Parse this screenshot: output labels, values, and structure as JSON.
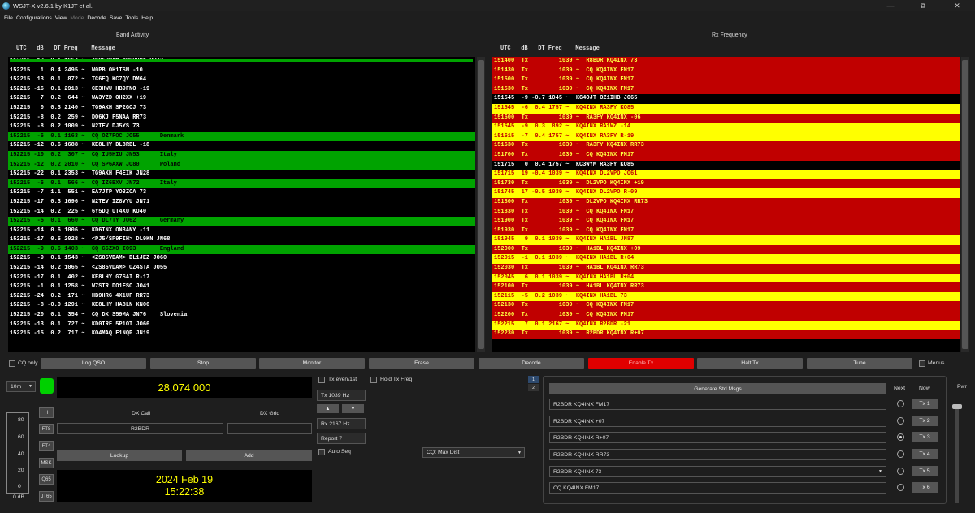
{
  "window": {
    "title": "WSJT-X   v2.6.1   by K1JT et al.",
    "min": "—",
    "max": "⧉",
    "close": "✕"
  },
  "menu": [
    "File",
    "Configurations",
    "View",
    "Mode",
    "Decode",
    "Save",
    "Tools",
    "Help"
  ],
  "band_activity": {
    "title": "Band Activity",
    "header": "UTC   dB   DT Freq    Message",
    "rows": [
      {
        "t": "152215 -13  0.1 1654 ~  ZS85VDAM <DH0VB> RR73",
        "s": "b"
      },
      {
        "t": "152215   1  0.4 2495 ~  W0PB OH1TSM -10",
        "s": "b"
      },
      {
        "t": "152215  13  0.1  872 ~  TC6EQ KC7QY DM64",
        "s": "b"
      },
      {
        "t": "152215 -16  0.1 2913 ~  CE3HWU HB9FNO -19",
        "s": "b"
      },
      {
        "t": "152215   7  0.2  644 ~  WA3YZD OH2XX +19",
        "s": "b"
      },
      {
        "t": "152215   0  0.3 2140 ~  TG9AKH SP2GCJ 73",
        "s": "b"
      },
      {
        "t": "152215  -8  0.2  259 ~  DO6KJ F5NAA RR73",
        "s": "b"
      },
      {
        "t": "152215  -8  0.2 1009 ~  N2TEV DJ5YS 73",
        "s": "b"
      },
      {
        "t": "152215  -6  0.1 1163 ~  CQ OZ7FOC JO55      Denmark",
        "s": "g"
      },
      {
        "t": "152215 -12  0.6 1688 ~  KE8LHY DL8RBL -18",
        "s": "b"
      },
      {
        "t": "152215 -10  0.2  307 ~  CQ IU5HIU JN53      Italy",
        "s": "g"
      },
      {
        "t": "152215 -12  0.2 2010 ~  CQ SP6AXW JO80      Poland",
        "s": "g"
      },
      {
        "t": "152215 -22  0.1 2353 ~  TG9AKH F4EIK JN28",
        "s": "b"
      },
      {
        "t": "152215  -6  0.1  566 ~  CQ IZ6BXV JN72      Italy",
        "s": "g"
      },
      {
        "t": "152215  -7  1.1  551 ~  EA7JTP YO3ZCA 73",
        "s": "b"
      },
      {
        "t": "152215 -17  0.3 1696 ~  N2TEV IZ8VYU JN71",
        "s": "b"
      },
      {
        "t": "152215 -14  0.2  225 ~  6Y5DQ UT4XU KO40",
        "s": "b"
      },
      {
        "t": "152215  -5  0.1  660 ~  CQ DL7TY JO62       Germany",
        "s": "g"
      },
      {
        "t": "152215 -14  0.6 1006 ~  KD6INX ON3ANY -11",
        "s": "b"
      },
      {
        "t": "152215 -17  0.5 2028 ~  <PJ5/SP9FIH> DL9KN JN68",
        "s": "b"
      },
      {
        "t": "152215  -9  0.6 1403 ~  CQ G6ZXO IO93       England",
        "s": "g"
      },
      {
        "t": "152215  -9  0.1 1543 ~  <ZS85VDAM> DL1JEZ JO60",
        "s": "b"
      },
      {
        "t": "152215 -14  0.2 1065 ~  <ZS85VDAM> OZ4STA JO55",
        "s": "b"
      },
      {
        "t": "152215 -17  0.1  402 ~  KE8LHY G7SAI R-17",
        "s": "b"
      },
      {
        "t": "152215  -1  0.1 1258 ~  W7STR DO1FSC JO41",
        "s": "b"
      },
      {
        "t": "152215 -24  0.2  171 ~  HB9HRG 4X1UF RR73",
        "s": "b"
      },
      {
        "t": "152215  -8 -0.0 1291 ~  KE8LHY HA8LN KN06",
        "s": "b"
      },
      {
        "t": "152215 -20  0.1  354 ~  CQ DX S59MA JN76    Slovenia",
        "s": "cq"
      },
      {
        "t": "152215 -13  0.1  727 ~  KD0IRF 5P1OT JO66",
        "s": "b"
      },
      {
        "t": "152215 -15  0.2  717 ~  KO4MAQ F1NQP JN19",
        "s": "b"
      }
    ]
  },
  "rx_frequency": {
    "title": "Rx Frequency",
    "header": "UTC   dB   DT Freq    Message",
    "rows": [
      {
        "t": "151400  Tx         1039 ~  R8BDR KQ4INX 73",
        "s": "r"
      },
      {
        "t": "151430  Tx         1039 ~  CQ KQ4INX FM17",
        "s": "r"
      },
      {
        "t": "151500  Tx         1039 ~  CQ KQ4INX FM17",
        "s": "r"
      },
      {
        "t": "151530  Tx         1039 ~  CQ KQ4INX FM17",
        "s": "r"
      },
      {
        "t": "151545  -9 -0.7 1045 ~  KG4OJT OZ1IHB JO65",
        "s": "b"
      },
      {
        "t": "151545  -6  0.4 1757 ~  KQ4INX RA3FY KO85",
        "s": "y"
      },
      {
        "t": "151600  Tx         1039 ~  RA3FY KQ4INX -06",
        "s": "r"
      },
      {
        "t": "151545  -9  0.3  892 ~  KQ4INX RA1WZ -14",
        "s": "y"
      },
      {
        "t": "151615  -7  0.4 1757 ~  KQ4INX RA3FY R-19",
        "s": "y"
      },
      {
        "t": "151630  Tx         1039 ~  RA3FY KQ4INX RR73",
        "s": "r"
      },
      {
        "t": "151700  Tx         1039 ~  CQ KQ4INX FM17",
        "s": "r"
      },
      {
        "t": "151715   0  0.4 1757 ~  KC3WYM RA3FY KO85",
        "s": "b"
      },
      {
        "t": "151715  19 -0.4 1039 ~  KQ4INX DL2VPO JO61",
        "s": "y"
      },
      {
        "t": "151730  Tx         1039 ~  DL2VPO KQ4INX +19",
        "s": "r"
      },
      {
        "t": "151745  17 -0.5 1039 ~  KQ4INX DL2VPO R-09",
        "s": "y"
      },
      {
        "t": "151800  Tx         1039 ~  DL2VPO KQ4INX RR73",
        "s": "r"
      },
      {
        "t": "151830  Tx         1039 ~  CQ KQ4INX FM17",
        "s": "r"
      },
      {
        "t": "151900  Tx         1039 ~  CQ KQ4INX FM17",
        "s": "r"
      },
      {
        "t": "151930  Tx         1039 ~  CQ KQ4INX FM17",
        "s": "r"
      },
      {
        "t": "151945   9  0.1 1039 ~  KQ4INX HA1BL JN87",
        "s": "y"
      },
      {
        "t": "152000  Tx         1039 ~  HA1BL KQ4INX +09",
        "s": "r"
      },
      {
        "t": "152015  -1  0.1 1039 ~  KQ4INX HA1BL R+04",
        "s": "y"
      },
      {
        "t": "152030  Tx         1039 ~  HA1BL KQ4INX RR73",
        "s": "r"
      },
      {
        "t": "152045   6  0.1 1039 ~  KQ4INX HA1BL R+04",
        "s": "y"
      },
      {
        "t": "152100  Tx         1039 ~  HA1BL KQ4INX RR73",
        "s": "r"
      },
      {
        "t": "152115  -5  0.2 1039 ~  KQ4INX HA1BL 73",
        "s": "y"
      },
      {
        "t": "152130  Tx         1039 ~  CQ KQ4INX FM17",
        "s": "r"
      },
      {
        "t": "152200  Tx         1039 ~  CQ KQ4INX FM17",
        "s": "r"
      },
      {
        "t": "152215   7  0.1 2167 ~  KQ4INX R2BDR -21",
        "s": "y"
      },
      {
        "t": "152230  Tx         1039 ~  R2BDR KQ4INX R+07",
        "s": "r"
      }
    ]
  },
  "buttons": {
    "cq_only": "CQ only",
    "log_qso": "Log QSO",
    "stop": "Stop",
    "monitor": "Monitor",
    "erase": "Erase",
    "decode": "Decode",
    "enable_tx": "Enable Tx",
    "halt_tx": "Halt Tx",
    "tune": "Tune",
    "menus": "Menus"
  },
  "band": "10m",
  "dial_freq": "28.074 000",
  "mode_buttons": [
    "H",
    "FT8",
    "FT4",
    "MSK",
    "Q65",
    "JT65"
  ],
  "meter": {
    "ticks": [
      "80",
      "60",
      "40",
      "20",
      "0"
    ],
    "value_label": "0 dB"
  },
  "dx": {
    "call_label": "DX Call",
    "grid_label": "DX Grid",
    "call": "R2BDR",
    "grid": "",
    "lookup": "Lookup",
    "add": "Add"
  },
  "clock": {
    "date": "2024 Feb 19",
    "time": "15:22:38"
  },
  "tx_controls": {
    "tx_even": "Tx even/1st",
    "hold_tx": "Hold Tx Freq",
    "tx_freq": "Tx  1039  Hz",
    "rx_freq": "Rx  2167  Hz",
    "report": "Report 7",
    "auto_seq": "Auto Seq",
    "cq_mode": "CQ: Max Dist",
    "up": "▲",
    "down": "▼"
  },
  "tabs": [
    "1",
    "2"
  ],
  "messages": {
    "generate": "Generate Std Msgs",
    "next_label": "Next",
    "now_label": "Now",
    "pwr_label": "Pwr",
    "items": [
      {
        "text": "R2BDR KQ4INX FM17",
        "tx": "Tx 1"
      },
      {
        "text": "R2BDR KQ4INX +07",
        "tx": "Tx 2"
      },
      {
        "text": "R2BDR KQ4INX R+07",
        "tx": "Tx 3"
      },
      {
        "text": "R2BDR KQ4INX RR73",
        "tx": "Tx 4"
      },
      {
        "text": "R2BDR KQ4INX 73",
        "tx": "Tx 5"
      },
      {
        "text": "CQ KQ4INX FM17",
        "tx": "Tx 6"
      }
    ],
    "selected_next": 2
  }
}
